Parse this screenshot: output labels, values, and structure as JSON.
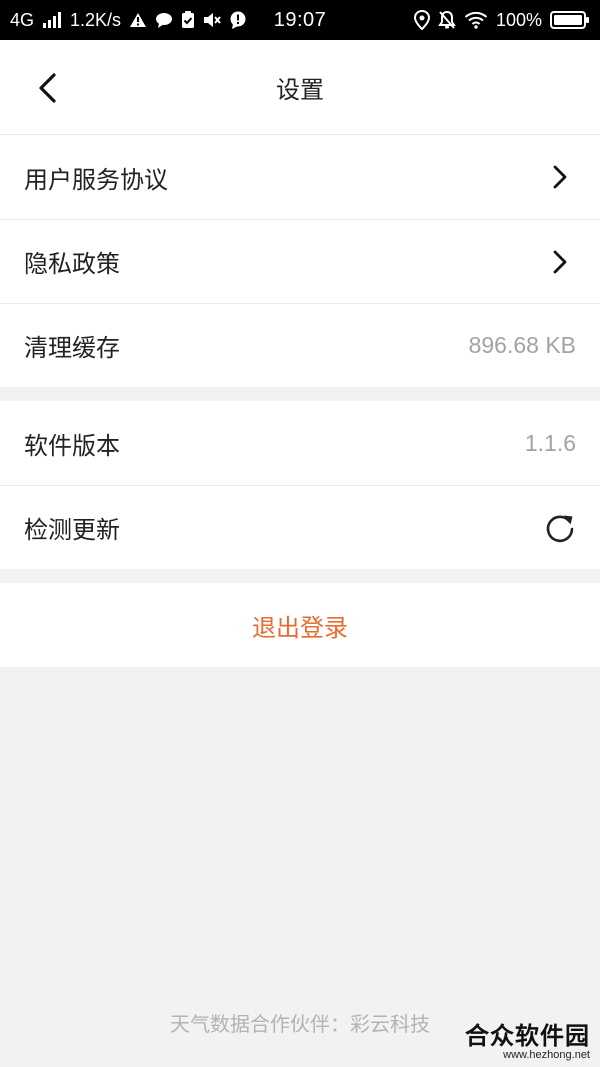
{
  "status_bar": {
    "network": "4G",
    "speed": "1.2K/s",
    "time": "19:07",
    "battery": "100%"
  },
  "header": {
    "title": "设置"
  },
  "group1": {
    "items": [
      {
        "label": "用户服务协议"
      },
      {
        "label": "隐私政策"
      },
      {
        "label": "清理缓存",
        "value": "896.68 KB"
      }
    ]
  },
  "group2": {
    "items": [
      {
        "label": "软件版本",
        "value": "1.1.6"
      },
      {
        "label": "检测更新"
      }
    ]
  },
  "logout": {
    "label": "退出登录",
    "color": "#e86b2f"
  },
  "footer": {
    "text": "天气数据合作伙伴：彩云科技"
  },
  "watermark": {
    "main": "合众软件园",
    "url": "www.hezhong.net"
  },
  "icons": {
    "back": "back-arrow-icon",
    "chevron": "chevron-right-icon",
    "refresh": "refresh-icon"
  }
}
